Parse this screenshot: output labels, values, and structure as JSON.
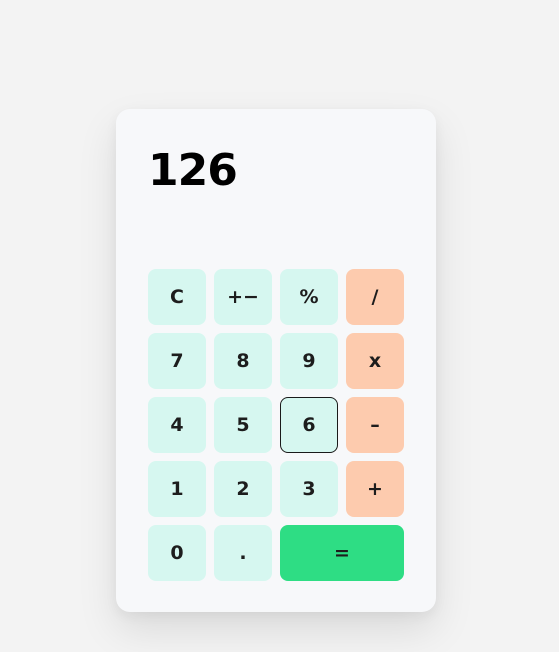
{
  "display": {
    "value": "126"
  },
  "keys": {
    "clear": "C",
    "plus_minus": "+−",
    "percent": "%",
    "divide": "/",
    "seven": "7",
    "eight": "8",
    "nine": "9",
    "multiply": "x",
    "four": "4",
    "five": "5",
    "six": "6",
    "subtract": "–",
    "one": "1",
    "two": "2",
    "three": "3",
    "add": "+",
    "zero": "0",
    "decimal": ".",
    "equals": "="
  },
  "colors": {
    "digit_key": "#d6f7f0",
    "operator_key": "#fdcbae",
    "equals_key": "#2edd84",
    "panel": "#f7f8fa",
    "page": "#f3f3f3"
  },
  "state": {
    "focused_key": "6"
  }
}
